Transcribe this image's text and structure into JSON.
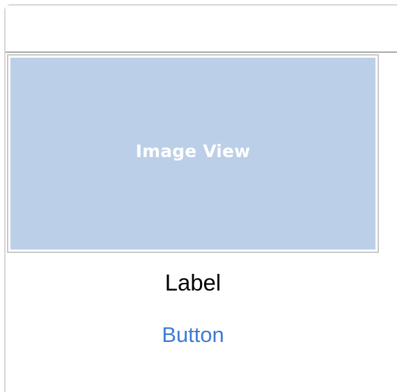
{
  "image_view": {
    "placeholder_text": "Image View",
    "fill_color": "#bccfe8"
  },
  "label": {
    "text": "Label"
  },
  "button": {
    "text": "Button",
    "color": "#3e7bd3"
  }
}
